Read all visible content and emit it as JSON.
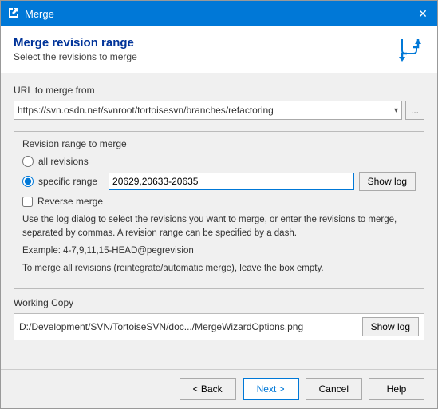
{
  "window": {
    "title": "Merge",
    "close_label": "✕"
  },
  "header": {
    "main_title": "Merge revision range",
    "sub_title": "Select the revisions to merge"
  },
  "url_section": {
    "label": "URL to merge from",
    "url_value": "https://svn.osdn.net/svnroot/tortoisesvn/branches/refactoring",
    "combo_arrow": "▾",
    "browse_label": "..."
  },
  "revision_group": {
    "title": "Revision range to merge",
    "all_revisions_label": "all revisions",
    "specific_range_label": "specific range",
    "range_value": "20629,20633-20635",
    "show_log_label": "Show log",
    "reverse_merge_label": "Reverse merge",
    "info_text": "Use the log dialog to select the revisions you want to merge, or enter the revisions to merge, separated by commas. A revision range can be specified by a dash.",
    "example_text": "Example: 4-7,9,11,15-HEAD@pegrevision",
    "empty_note": "To merge all revisions (reintegrate/automatic merge), leave the box empty."
  },
  "working_copy": {
    "label": "Working Copy",
    "path": "D:/Development/SVN/TortoiseSVN/doc.../MergeWizardOptions.png",
    "show_log_label": "Show log"
  },
  "footer": {
    "back_label": "< Back",
    "next_label": "Next >",
    "cancel_label": "Cancel",
    "help_label": "Help"
  }
}
